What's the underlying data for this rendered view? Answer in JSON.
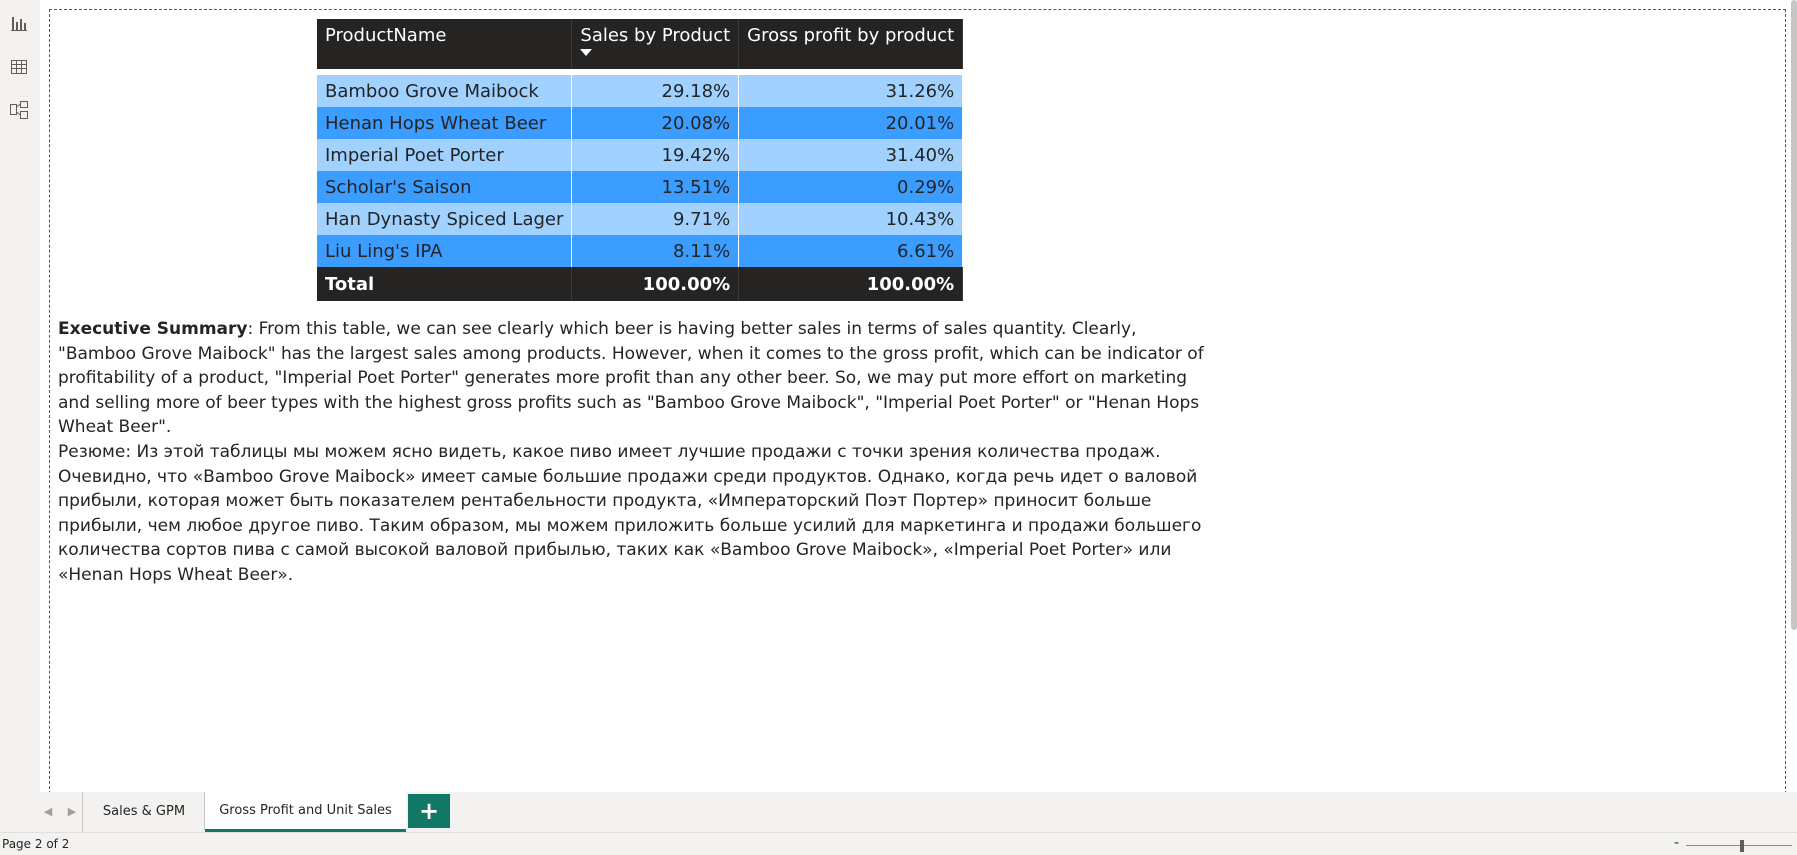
{
  "left_rail": {
    "icons": [
      "report-view-icon",
      "table-view-icon",
      "model-view-icon"
    ]
  },
  "table": {
    "headers": [
      "ProductName",
      "Sales by Product",
      "Gross profit by product"
    ],
    "rows": [
      {
        "product": "Bamboo Grove Maibock",
        "sales": "29.18%",
        "gross_profit": "31.26%"
      },
      {
        "product": "Henan Hops Wheat Beer",
        "sales": "20.08%",
        "gross_profit": "20.01%"
      },
      {
        "product": "Imperial Poet Porter",
        "sales": "19.42%",
        "gross_profit": "31.40%"
      },
      {
        "product": "Scholar's Saison",
        "sales": "13.51%",
        "gross_profit": "0.29%"
      },
      {
        "product": "Han Dynasty Spiced Lager",
        "sales": "9.71%",
        "gross_profit": "10.43%"
      },
      {
        "product": "Liu Ling's IPA",
        "sales": "8.11%",
        "gross_profit": "6.61%"
      }
    ],
    "total": {
      "label": "Total",
      "sales": "100.00%",
      "gross_profit": "100.00%"
    },
    "colors": {
      "header": "#252423",
      "row_light": "#a0d1ff",
      "row_dark": "#3a9dff"
    }
  },
  "summary_en": {
    "label": "Executive Summary",
    "text": ":  From this table, we can see clearly which beer is having better sales in terms of sales quantity. Clearly, \"Bamboo Grove Maibock\" has the largest sales among products. However, when it comes to the gross profit, which can be indicator of profitability of a product, \"Imperial Poet Porter\" generates more profit than any other beer. So, we may put more effort on marketing and selling more of beer types with the highest gross profits such as \"Bamboo Grove Maibock\", \"Imperial Poet Porter\" or \"Henan Hops Wheat Beer\"."
  },
  "summary_ru": {
    "text": "Резюме: Из этой таблицы мы можем ясно видеть, какое пиво имеет лучшие продажи с точки зрения количества продаж. Очевидно, что «Bamboo Grove Maibock» имеет самые большие продажи среди продуктов. Однако, когда речь идет о валовой прибыли, которая может быть показателем рентабельности продукта, «Императорский Поэт Портер» приносит больше прибыли, чем любое другое пиво. Таким образом, мы можем приложить больше усилий для маркетинга и продажи большего количества сортов пива с самой высокой валовой прибылью, таких как «Bamboo Grove Maibock», «Imperial Poet Porter» или «Henan Hops Wheat Beer»."
  },
  "tabs": [
    {
      "label": "Sales & GPM",
      "active": false
    },
    {
      "label": "Gross Profit and Unit Sales",
      "active": true
    }
  ],
  "add_page_label": "+",
  "status": {
    "page_indicator": "Page 2 of 2",
    "zoom_minus": "-"
  },
  "accent_color": "#117865"
}
